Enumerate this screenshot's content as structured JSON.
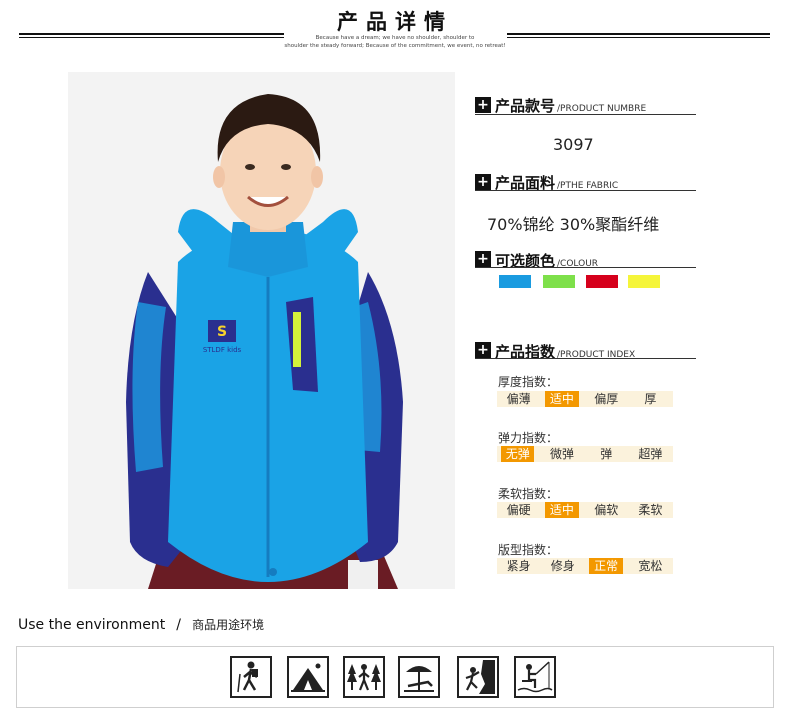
{
  "header": {
    "title": "产品详情",
    "tagline_1": "Because have a dream; we have no shoulder, shoulder to",
    "tagline_2": "shoulder the steady forward; Because of the commitment, we event, no retreat!"
  },
  "product": {
    "number_label": "产品款号",
    "number_label_en": "/PRODUCT NUMBRE",
    "number_value": "3097",
    "fabric_label": "产品面料",
    "fabric_label_en": "/PTHE FABRIC",
    "fabric_value": "70%锦纶  30%聚酯纤维",
    "colour_label": "可选颜色",
    "colour_label_en": "/COLOUR",
    "colours": [
      "#1a9be0",
      "#7ee04a",
      "#d6001c",
      "#f5f53a"
    ],
    "index_label": "产品指数",
    "index_label_en": "/PRODUCT INDEX",
    "photo_badge": "STLDF kids"
  },
  "indices": [
    {
      "label": "厚度指数：",
      "options": [
        "偏薄",
        "适中",
        "偏厚",
        "厚"
      ],
      "selected": 1
    },
    {
      "label": "弹力指数：",
      "options": [
        "无弹",
        "微弹",
        "弹",
        "超弹"
      ],
      "selected": 0
    },
    {
      "label": "柔软指数：",
      "options": [
        "偏硬",
        "适中",
        "偏软",
        "柔软"
      ],
      "selected": 1
    },
    {
      "label": "版型指数：",
      "options": [
        "紧身",
        "修身",
        "正常",
        "宽松"
      ],
      "selected": 2
    }
  ],
  "use": {
    "title_en": "Use the environment",
    "separator": "/",
    "title_cn": "商品用途环境",
    "icons": [
      "hiking-icon",
      "camping-icon",
      "forest-walk-icon",
      "beach-lounge-icon",
      "rock-climbing-icon",
      "fishing-icon"
    ]
  }
}
